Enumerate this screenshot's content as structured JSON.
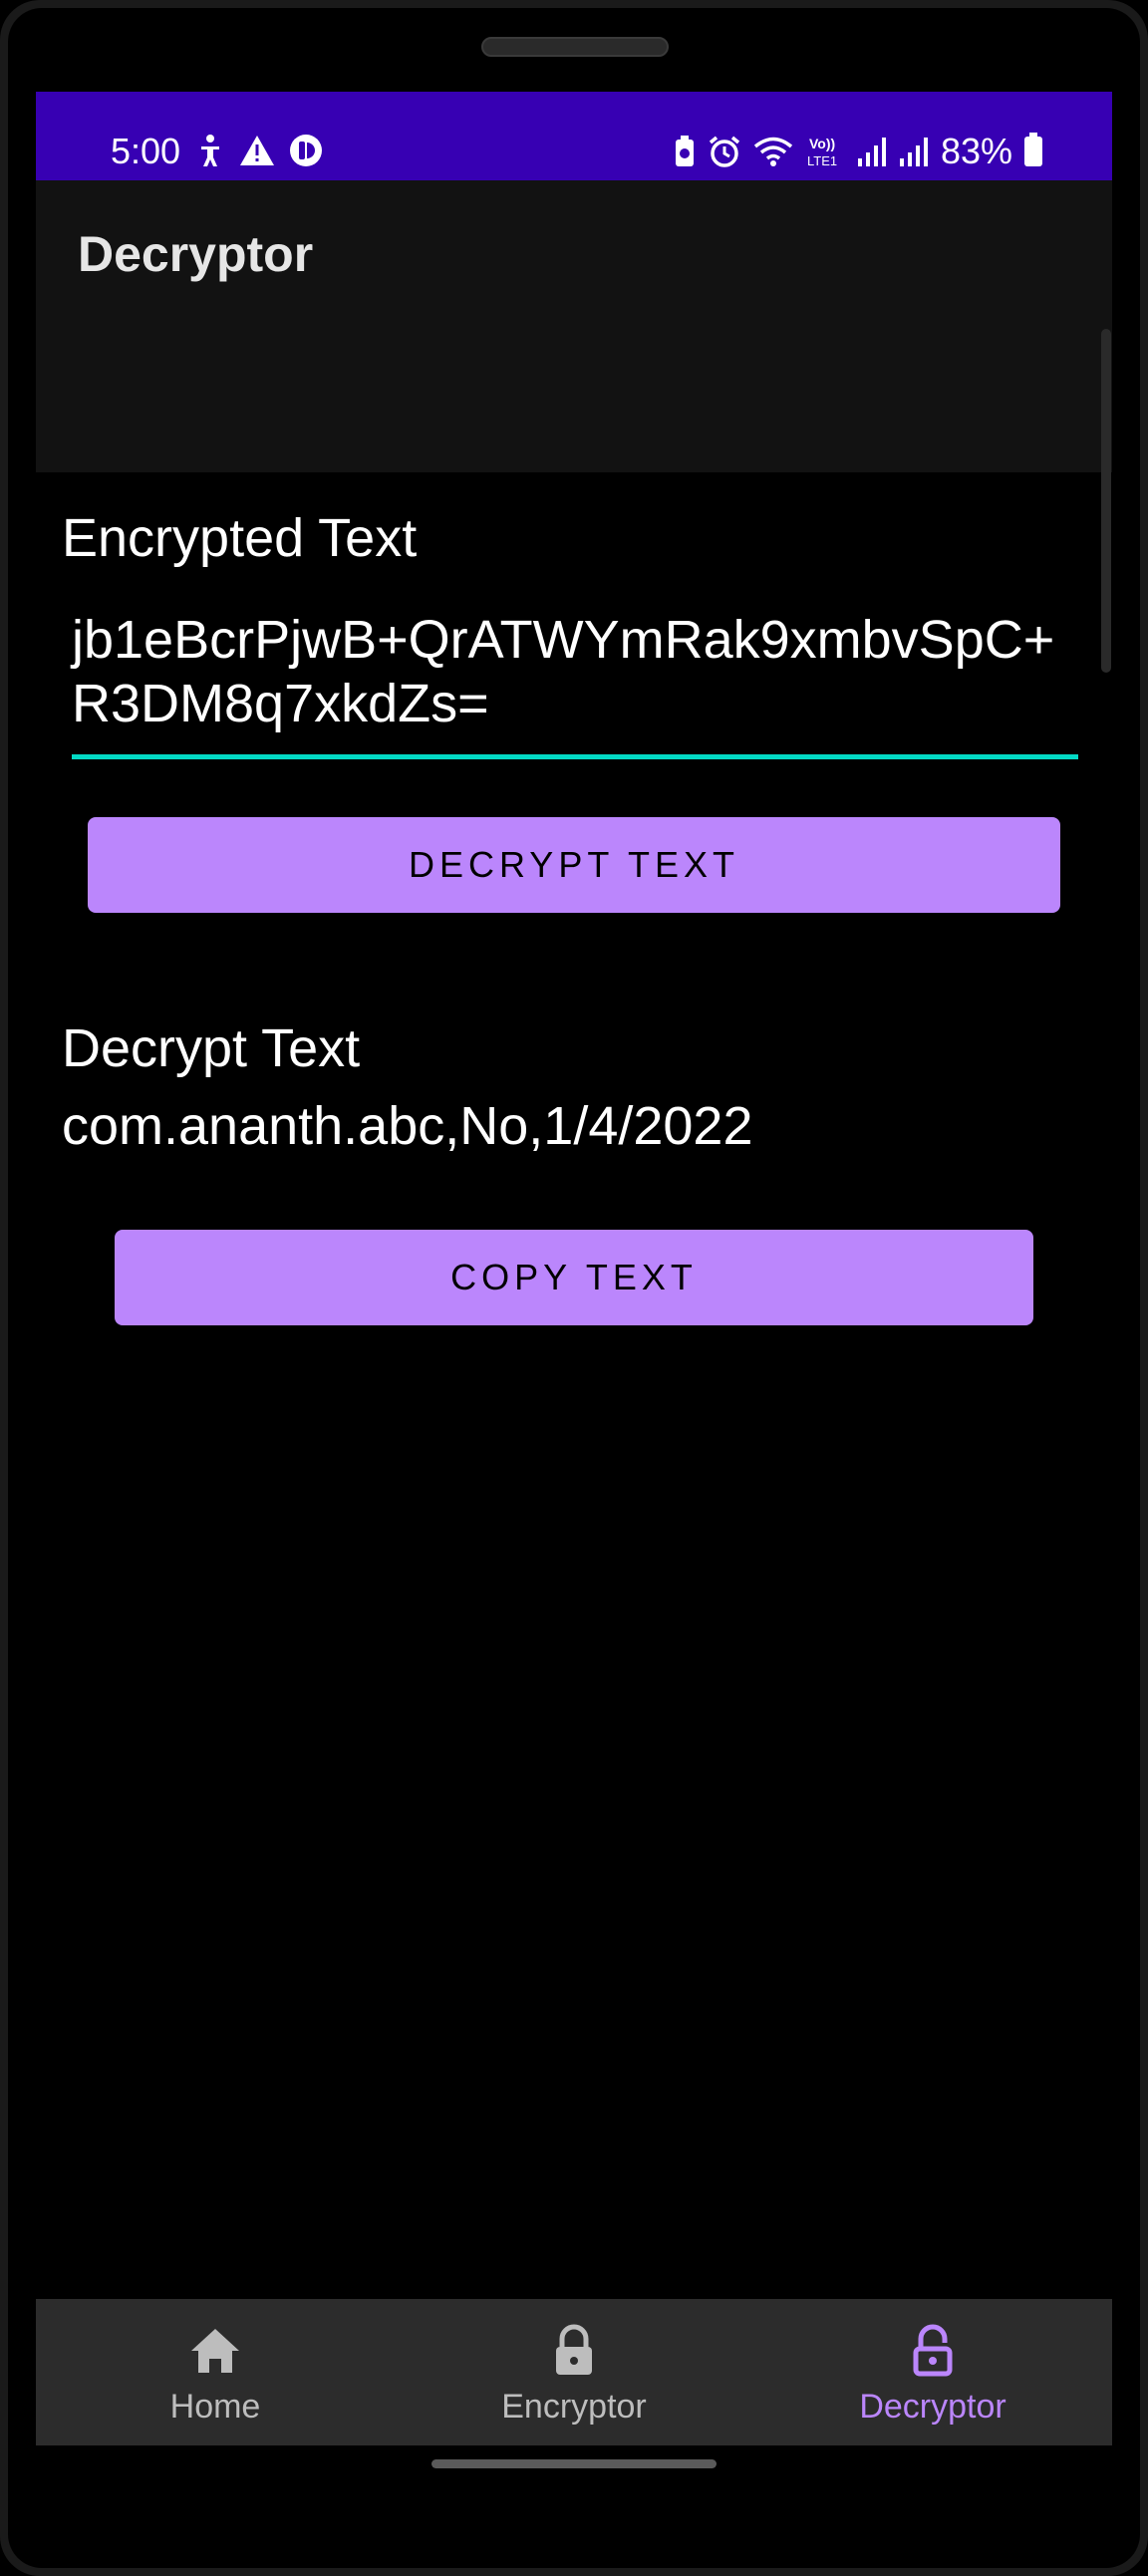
{
  "status_bar": {
    "time": "5:00",
    "battery": "83%",
    "left_icons": [
      "accessibility-icon",
      "warning-icon",
      "media-icon"
    ],
    "right_icons": [
      "battery-saver-icon",
      "alarm-icon",
      "wifi-icon",
      "volte-icon",
      "signal-icon",
      "signal-icon"
    ]
  },
  "app_bar": {
    "title": "Decryptor"
  },
  "main": {
    "encrypted_label": "Encrypted Text",
    "encrypted_value": "jb1eBcrPjwB+QrATWYmRak9xmbvSpC+R3DM8q7xkdZs=",
    "decrypt_button": "DECRYPT TEXT",
    "decrypt_label": "Decrypt Text",
    "decrypted_value": "com.ananth.abc,No,1/4/2022",
    "copy_button": "COPY TEXT"
  },
  "bottom_nav": {
    "items": [
      {
        "label": "Home",
        "icon": "home-icon",
        "active": false
      },
      {
        "label": "Encryptor",
        "icon": "lock-icon",
        "active": false
      },
      {
        "label": "Decryptor",
        "icon": "unlock-icon",
        "active": true
      }
    ]
  },
  "colors": {
    "status_bar": "#3700b3",
    "accent": "#bb86fc",
    "field_underline": "#03dac5",
    "app_bar": "#121212",
    "bottom_nav": "#2c2c2c"
  }
}
